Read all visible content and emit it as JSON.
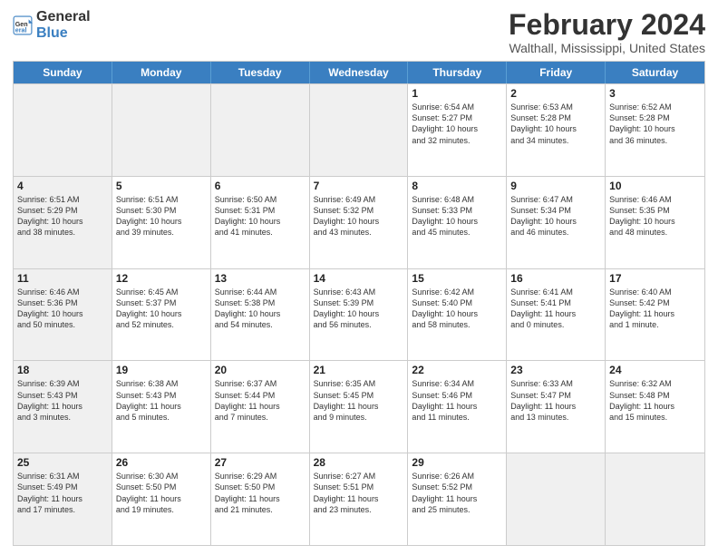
{
  "logo": {
    "line1": "General",
    "line2": "Blue"
  },
  "title": "February 2024",
  "subtitle": "Walthall, Mississippi, United States",
  "days_of_week": [
    "Sunday",
    "Monday",
    "Tuesday",
    "Wednesday",
    "Thursday",
    "Friday",
    "Saturday"
  ],
  "weeks": [
    [
      {
        "day": "",
        "info": "",
        "shaded": true
      },
      {
        "day": "",
        "info": "",
        "shaded": true
      },
      {
        "day": "",
        "info": "",
        "shaded": true
      },
      {
        "day": "",
        "info": "",
        "shaded": true
      },
      {
        "day": "1",
        "info": "Sunrise: 6:54 AM\nSunset: 5:27 PM\nDaylight: 10 hours\nand 32 minutes."
      },
      {
        "day": "2",
        "info": "Sunrise: 6:53 AM\nSunset: 5:28 PM\nDaylight: 10 hours\nand 34 minutes."
      },
      {
        "day": "3",
        "info": "Sunrise: 6:52 AM\nSunset: 5:28 PM\nDaylight: 10 hours\nand 36 minutes."
      }
    ],
    [
      {
        "day": "4",
        "info": "Sunrise: 6:51 AM\nSunset: 5:29 PM\nDaylight: 10 hours\nand 38 minutes.",
        "shaded": true
      },
      {
        "day": "5",
        "info": "Sunrise: 6:51 AM\nSunset: 5:30 PM\nDaylight: 10 hours\nand 39 minutes."
      },
      {
        "day": "6",
        "info": "Sunrise: 6:50 AM\nSunset: 5:31 PM\nDaylight: 10 hours\nand 41 minutes."
      },
      {
        "day": "7",
        "info": "Sunrise: 6:49 AM\nSunset: 5:32 PM\nDaylight: 10 hours\nand 43 minutes."
      },
      {
        "day": "8",
        "info": "Sunrise: 6:48 AM\nSunset: 5:33 PM\nDaylight: 10 hours\nand 45 minutes."
      },
      {
        "day": "9",
        "info": "Sunrise: 6:47 AM\nSunset: 5:34 PM\nDaylight: 10 hours\nand 46 minutes."
      },
      {
        "day": "10",
        "info": "Sunrise: 6:46 AM\nSunset: 5:35 PM\nDaylight: 10 hours\nand 48 minutes."
      }
    ],
    [
      {
        "day": "11",
        "info": "Sunrise: 6:46 AM\nSunset: 5:36 PM\nDaylight: 10 hours\nand 50 minutes.",
        "shaded": true
      },
      {
        "day": "12",
        "info": "Sunrise: 6:45 AM\nSunset: 5:37 PM\nDaylight: 10 hours\nand 52 minutes."
      },
      {
        "day": "13",
        "info": "Sunrise: 6:44 AM\nSunset: 5:38 PM\nDaylight: 10 hours\nand 54 minutes."
      },
      {
        "day": "14",
        "info": "Sunrise: 6:43 AM\nSunset: 5:39 PM\nDaylight: 10 hours\nand 56 minutes."
      },
      {
        "day": "15",
        "info": "Sunrise: 6:42 AM\nSunset: 5:40 PM\nDaylight: 10 hours\nand 58 minutes."
      },
      {
        "day": "16",
        "info": "Sunrise: 6:41 AM\nSunset: 5:41 PM\nDaylight: 11 hours\nand 0 minutes."
      },
      {
        "day": "17",
        "info": "Sunrise: 6:40 AM\nSunset: 5:42 PM\nDaylight: 11 hours\nand 1 minute."
      }
    ],
    [
      {
        "day": "18",
        "info": "Sunrise: 6:39 AM\nSunset: 5:43 PM\nDaylight: 11 hours\nand 3 minutes.",
        "shaded": true
      },
      {
        "day": "19",
        "info": "Sunrise: 6:38 AM\nSunset: 5:43 PM\nDaylight: 11 hours\nand 5 minutes."
      },
      {
        "day": "20",
        "info": "Sunrise: 6:37 AM\nSunset: 5:44 PM\nDaylight: 11 hours\nand 7 minutes."
      },
      {
        "day": "21",
        "info": "Sunrise: 6:35 AM\nSunset: 5:45 PM\nDaylight: 11 hours\nand 9 minutes."
      },
      {
        "day": "22",
        "info": "Sunrise: 6:34 AM\nSunset: 5:46 PM\nDaylight: 11 hours\nand 11 minutes."
      },
      {
        "day": "23",
        "info": "Sunrise: 6:33 AM\nSunset: 5:47 PM\nDaylight: 11 hours\nand 13 minutes."
      },
      {
        "day": "24",
        "info": "Sunrise: 6:32 AM\nSunset: 5:48 PM\nDaylight: 11 hours\nand 15 minutes."
      }
    ],
    [
      {
        "day": "25",
        "info": "Sunrise: 6:31 AM\nSunset: 5:49 PM\nDaylight: 11 hours\nand 17 minutes.",
        "shaded": true
      },
      {
        "day": "26",
        "info": "Sunrise: 6:30 AM\nSunset: 5:50 PM\nDaylight: 11 hours\nand 19 minutes."
      },
      {
        "day": "27",
        "info": "Sunrise: 6:29 AM\nSunset: 5:50 PM\nDaylight: 11 hours\nand 21 minutes."
      },
      {
        "day": "28",
        "info": "Sunrise: 6:27 AM\nSunset: 5:51 PM\nDaylight: 11 hours\nand 23 minutes."
      },
      {
        "day": "29",
        "info": "Sunrise: 6:26 AM\nSunset: 5:52 PM\nDaylight: 11 hours\nand 25 minutes."
      },
      {
        "day": "",
        "info": "",
        "shaded": true
      },
      {
        "day": "",
        "info": "",
        "shaded": true
      }
    ]
  ]
}
